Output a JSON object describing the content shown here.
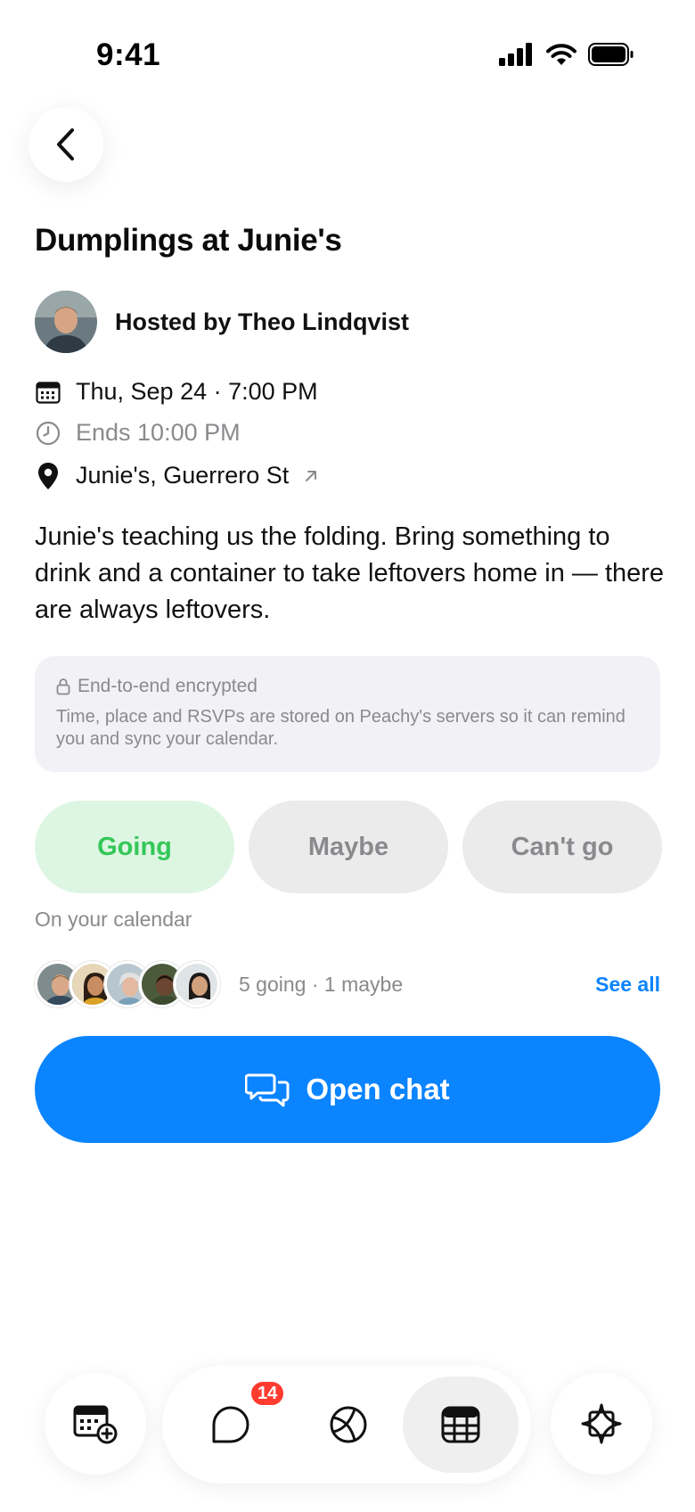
{
  "status": {
    "time": "9:41"
  },
  "event": {
    "title": "Dumplings at Junie's",
    "host": "Hosted by Theo Lindqvist",
    "date": "Thu, Sep 24 · 7:00 PM",
    "ends": "Ends 10:00 PM",
    "location": "Junie's, Guerrero St",
    "description": "Junie's teaching us the folding. Bring something to drink and a container to take leftovers home in — there are always leftovers."
  },
  "encryption": {
    "title": "End-to-end encrypted",
    "body": "Time, place and RSVPs are stored on Peachy's servers so it can remind you and sync your calendar."
  },
  "rsvp": {
    "going": "Going",
    "maybe": "Maybe",
    "cant_go": "Can't go",
    "selected": "going",
    "note": "On your calendar"
  },
  "attendees": {
    "summary": "5 going · 1 maybe",
    "see_all": "See all"
  },
  "actions": {
    "open_chat": "Open chat"
  },
  "tabbar": {
    "chat_badge": "14",
    "active_tab": "events"
  },
  "colors": {
    "accent": "#0a84ff",
    "going": "#34c759",
    "going_bg": "#ddf6e2",
    "badge": "#ff3b30"
  }
}
